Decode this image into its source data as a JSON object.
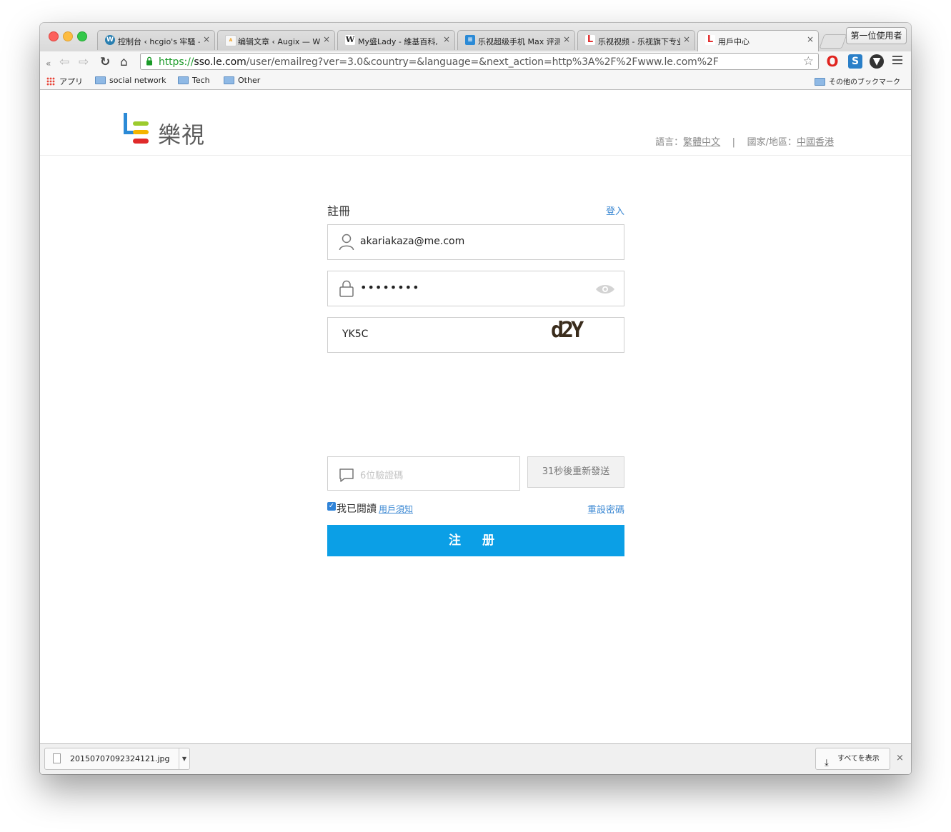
{
  "browser": {
    "tabs": [
      {
        "title": "控制台 ‹ hcgio's 牢騷 —",
        "favicon": "wordpress-icon",
        "color": "#2a7fb0"
      },
      {
        "title": "编辑文章 ‹ Augix — Wo",
        "favicon": "augix-icon",
        "color": "#f0a020"
      },
      {
        "title": "My盛Lady - 維基百科,",
        "favicon": "wikipedia-icon",
        "color": "#222222"
      },
      {
        "title": "乐视超级手机 Max 评测",
        "favicon": "doc-icon",
        "color": "#2b8ad6"
      },
      {
        "title": "乐视视频 - 乐视旗下专业",
        "favicon": "letv-icon",
        "color": "#e02a2a"
      },
      {
        "title": "用戶中心",
        "favicon": "letv-icon",
        "color": "#e02a2a"
      }
    ],
    "close_glyph": "×",
    "profile_button": "第一位使用者",
    "url": {
      "scheme": "https://",
      "host": "sso.le.com",
      "path": "/user/emailreg?ver=3.0&country=&language=&next_action=http%3A%2F%2Fwww.le.com%2F"
    },
    "bookmarks": {
      "apps": "アプリ",
      "items": [
        "social network",
        "Tech",
        "Other"
      ],
      "other": "その他のブックマーク"
    }
  },
  "site": {
    "logo_text": "樂視",
    "lang_label": "語言：",
    "lang_value": "繁體中文",
    "separator": "|",
    "region_label": "國家/地區：",
    "region_value": "中國香港"
  },
  "form": {
    "title": "註冊",
    "login_link": "登入",
    "email": "akariakaza@me.com",
    "password": "••••••••",
    "captcha_value": "YK5C",
    "captcha_image_text": "d2Y",
    "sms_placeholder": "6位驗證碼",
    "resend_label": "31秒後重新發送",
    "agree_label": "我已閱讀",
    "terms_link": "用戶須知",
    "reset_link": "重設密碼",
    "submit_label": "注 册"
  },
  "downloads": {
    "filename": "20150707092324121.jpg",
    "show_all": "すべてを表示",
    "close_glyph": "×"
  },
  "colors": {
    "accent": "#0b9fe6",
    "link": "#3b88d3"
  }
}
